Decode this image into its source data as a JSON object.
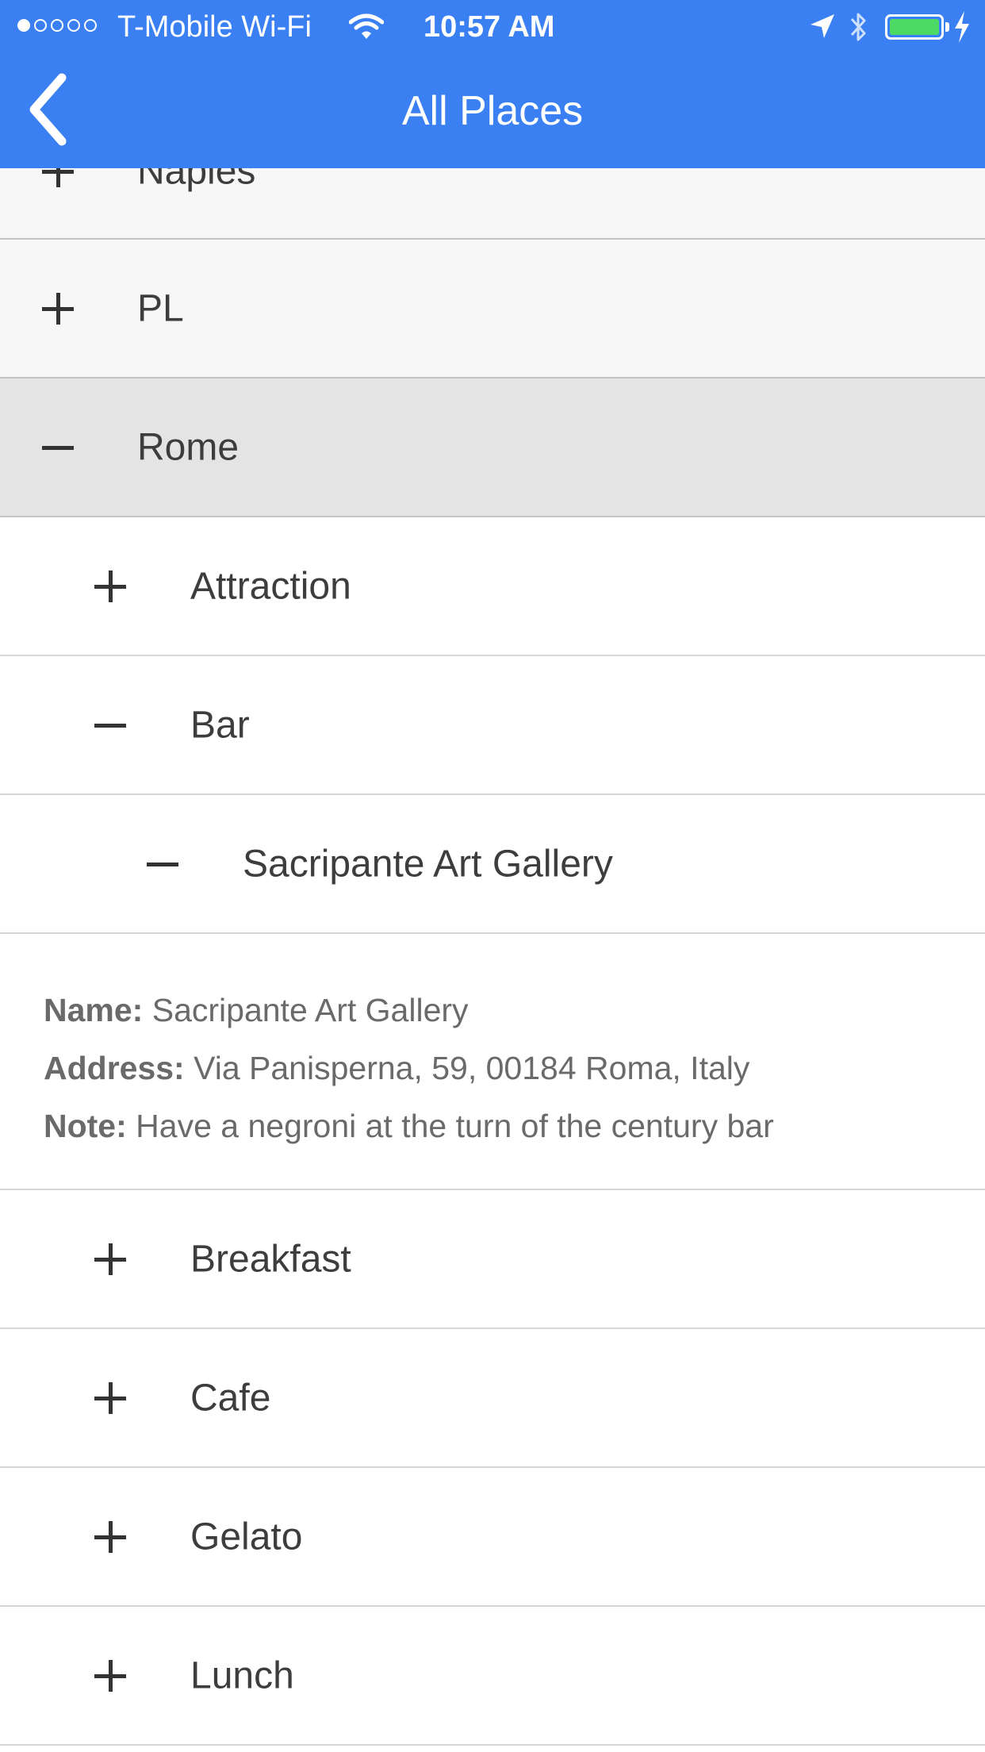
{
  "status_bar": {
    "carrier": "T-Mobile Wi-Fi",
    "time": "10:57 AM",
    "signal_bars_filled": 1,
    "signal_bars_total": 5,
    "battery_level": 1.0,
    "battery_color": "#4cd964",
    "icons": [
      "signal-dots-icon",
      "wifi-icon",
      "location-arrow-icon",
      "bluetooth-icon",
      "battery-icon",
      "charging-bolt-icon"
    ]
  },
  "nav": {
    "title": "All Places",
    "back_icon": "chevron-left-icon",
    "background": "#3a80f3"
  },
  "tree": {
    "cities": [
      {
        "label": "Naples",
        "state": "collapsed"
      },
      {
        "label": "PL",
        "state": "collapsed"
      },
      {
        "label": "Rome",
        "state": "expanded"
      }
    ],
    "rome_categories": [
      {
        "label": "Attraction",
        "state": "collapsed"
      },
      {
        "label": "Bar",
        "state": "expanded"
      },
      {
        "label": "Breakfast",
        "state": "collapsed"
      },
      {
        "label": "Cafe",
        "state": "collapsed"
      },
      {
        "label": "Gelato",
        "state": "collapsed"
      },
      {
        "label": "Lunch",
        "state": "collapsed"
      }
    ],
    "bar_places": [
      {
        "label": "Sacripante Art Gallery",
        "state": "expanded"
      }
    ],
    "place_details": {
      "name_key": "Name:",
      "name_value": "Sacripante Art Gallery",
      "address_key": "Address:",
      "address_value": "Via Panisperna, 59, 00184 Roma, Italy",
      "note_key": "Note:",
      "note_value": "Have a negroni at the turn of the century bar"
    }
  }
}
